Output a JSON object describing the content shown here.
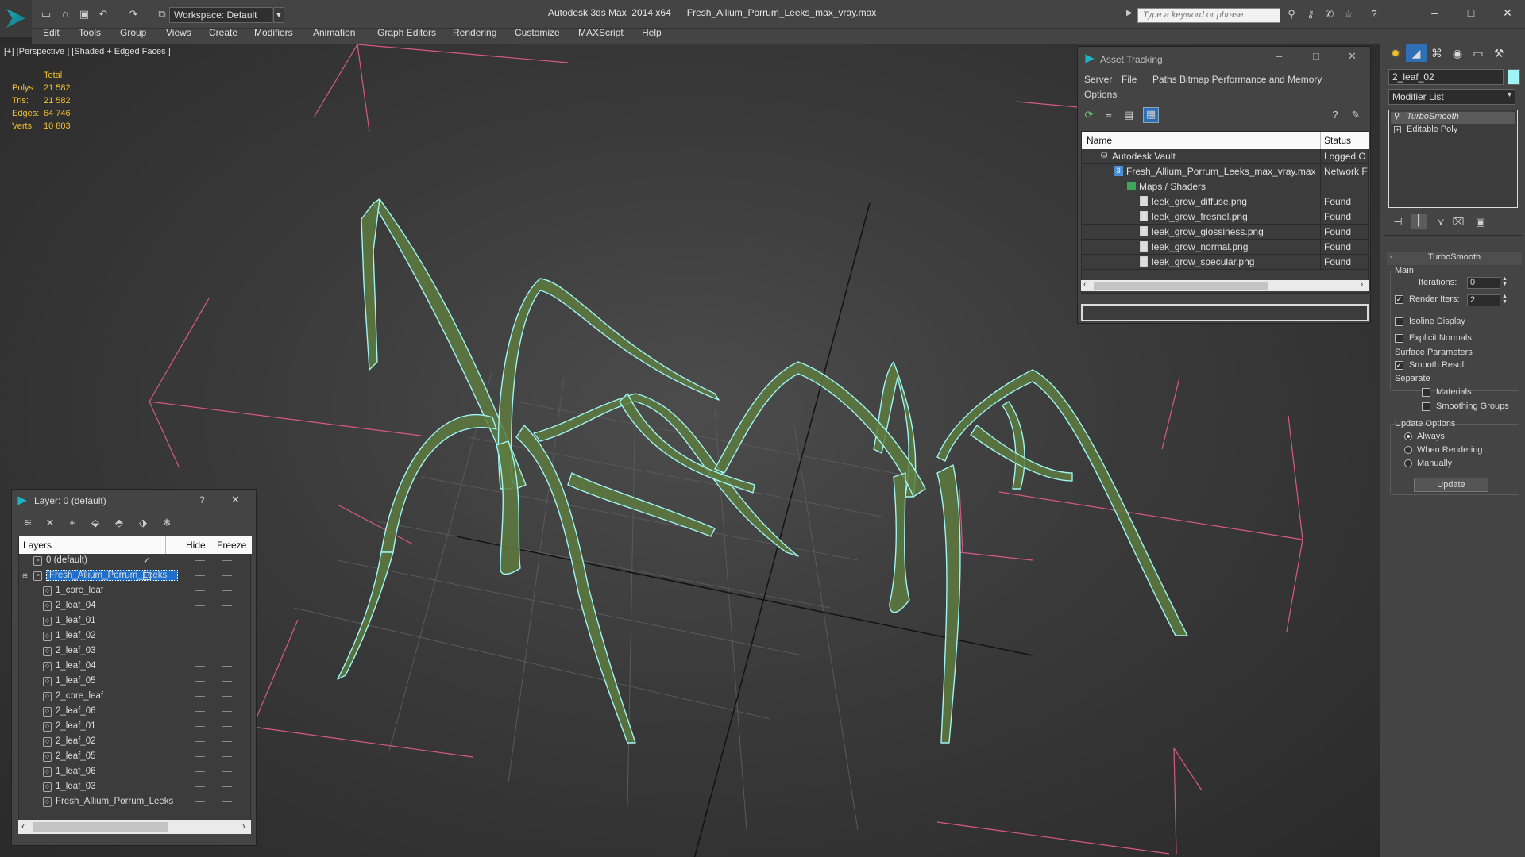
{
  "app": {
    "title": "Autodesk 3ds Max  2014 x64",
    "file": "Fresh_Allium_Porrum_Leeks_max_vray.max",
    "workspace": "Workspace: Default",
    "search_placeholder": "Type a keyword or phrase"
  },
  "menu": [
    "Edit",
    "Tools",
    "Group",
    "Views",
    "Create",
    "Modifiers",
    "Animation",
    "Graph Editors",
    "Rendering",
    "Customize",
    "MAXScript",
    "Help"
  ],
  "viewport": {
    "label": "[+] [Perspective ] [Shaded + Edged Faces ]",
    "stats": {
      "total_label": "Total",
      "rows": [
        {
          "label": "Polys:",
          "value": "21 582"
        },
        {
          "label": "Tris:",
          "value": "21 582"
        },
        {
          "label": "Edges:",
          "value": "64 746"
        },
        {
          "label": "Verts:",
          "value": "10 803"
        }
      ]
    }
  },
  "asset_tracking": {
    "title": "Asset Tracking",
    "menu": [
      "Server",
      "File",
      "Paths",
      "Bitmap Performance and Memory"
    ],
    "menu2": "Options",
    "columns": {
      "name": "Name",
      "status": "Status"
    },
    "rows": [
      {
        "name": "Autodesk Vault",
        "status": "Logged O",
        "icon": "vault-icon"
      },
      {
        "name": "Fresh_Allium_Porrum_Leeks_max_vray.max",
        "status": "Network F",
        "icon": "max-file-icon"
      },
      {
        "name": "Maps / Shaders",
        "status": "",
        "icon": "maps-icon"
      },
      {
        "name": "leek_grow_diffuse.png",
        "status": "Found",
        "icon": "image-file-icon"
      },
      {
        "name": "leek_grow_fresnel.png",
        "status": "Found",
        "icon": "image-file-icon"
      },
      {
        "name": "leek_grow_glossiness.png",
        "status": "Found",
        "icon": "image-file-icon"
      },
      {
        "name": "leek_grow_normal.png",
        "status": "Found",
        "icon": "image-file-icon"
      },
      {
        "name": "leek_grow_specular.png",
        "status": "Found",
        "icon": "image-file-icon"
      }
    ]
  },
  "layer_explorer": {
    "title": "Layer: 0 (default)",
    "help": "?",
    "columns": {
      "layers": "Layers",
      "hide": "Hide",
      "freeze": "Freeze"
    },
    "rows": [
      {
        "name": "0 (default)",
        "level": 0,
        "selected": false
      },
      {
        "name": "Fresh_Allium_Porrum_Leeks",
        "level": 0,
        "selected": true
      },
      {
        "name": "1_core_leaf",
        "level": 1,
        "selected": false
      },
      {
        "name": "2_leaf_04",
        "level": 1,
        "selected": false
      },
      {
        "name": "1_leaf_01",
        "level": 1,
        "selected": false
      },
      {
        "name": "1_leaf_02",
        "level": 1,
        "selected": false
      },
      {
        "name": "2_leaf_03",
        "level": 1,
        "selected": false
      },
      {
        "name": "1_leaf_04",
        "level": 1,
        "selected": false
      },
      {
        "name": "1_leaf_05",
        "level": 1,
        "selected": false
      },
      {
        "name": "2_core_leaf",
        "level": 1,
        "selected": false
      },
      {
        "name": "2_leaf_06",
        "level": 1,
        "selected": false
      },
      {
        "name": "2_leaf_01",
        "level": 1,
        "selected": false
      },
      {
        "name": "2_leaf_02",
        "level": 1,
        "selected": false
      },
      {
        "name": "2_leaf_05",
        "level": 1,
        "selected": false
      },
      {
        "name": "1_leaf_06",
        "level": 1,
        "selected": false
      },
      {
        "name": "1_leaf_03",
        "level": 1,
        "selected": false
      },
      {
        "name": "Fresh_Allium_Porrum_Leeks",
        "level": 1,
        "selected": false
      }
    ]
  },
  "command_panel": {
    "object_name": "2_leaf_02",
    "object_color": "#9ff5f5",
    "modifier_list": "Modifier List",
    "stack": [
      "TurboSmooth",
      "Editable Poly"
    ],
    "rollout_title": "TurboSmooth",
    "main_label": "Main",
    "iterations_label": "Iterations:",
    "iterations_value": "0",
    "render_iters_label": "Render Iters:",
    "render_iters_value": "2",
    "render_iters_checked": true,
    "isoline_label": "Isoline Display",
    "explicit_normals_label": "Explicit Normals",
    "surface_params_label": "Surface Parameters",
    "smooth_result_label": "Smooth Result",
    "separate_label": "Separate",
    "materials_label": "Materials",
    "smoothing_groups_label": "Smoothing Groups",
    "update_options_label": "Update Options",
    "always_label": "Always",
    "when_rendering_label": "When Rendering",
    "manually_label": "Manually",
    "update_button": "Update"
  },
  "colors": {
    "wire": "#9ff5f5",
    "leaf_fill": "#5d7a3f",
    "bbox": "#d85a82",
    "selection": "#1e6fc9"
  }
}
